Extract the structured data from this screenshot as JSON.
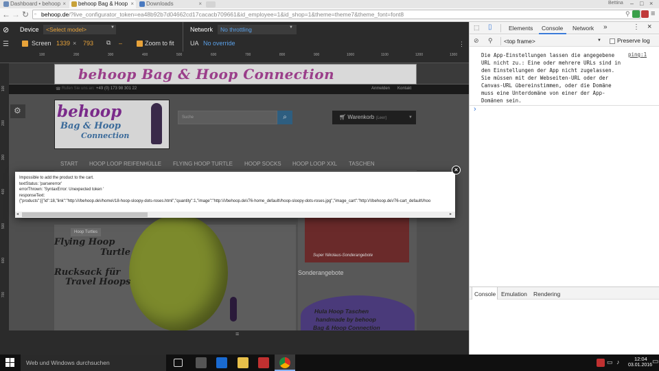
{
  "browser": {
    "tabs": [
      {
        "label": "Dashboard • behoop"
      },
      {
        "label": "behoop Bag & Hoop"
      },
      {
        "label": "Downloads"
      }
    ],
    "window_user": "Bettina",
    "url_domain": "behoop.de",
    "url_rest": "/?live_configurator_token=ea48b92b7d04662cd17cacacb709661&id_employee=1&id_shop=1&theme=theme7&theme_font=font8"
  },
  "device_toolbar": {
    "device_label": "Device",
    "device_select": "<Select model>",
    "screen_label": "Screen",
    "screen_w": "1339",
    "times": "×",
    "screen_h": "793",
    "dash": "–",
    "zoom_label": "Zoom to fit",
    "network_label": "Network",
    "network_value": "No throttling",
    "ua_label": "UA",
    "ua_value": "No override"
  },
  "rulers": {
    "top_ticks": [
      "100",
      "200",
      "300",
      "400",
      "500",
      "600",
      "700",
      "800",
      "900",
      "1000",
      "1100",
      "1200",
      "1300"
    ],
    "left_ticks": [
      "100",
      "200",
      "300",
      "400",
      "500",
      "600",
      "700"
    ]
  },
  "site": {
    "banner": "behoop  Bag & Hoop  Connection",
    "contact_phone": "+49 (0) 173 98 301 22",
    "contact_prefix": "Rufen Sie uns an:",
    "top_links": [
      "Anmelden",
      "Kontakt"
    ],
    "logo_main": "behoop",
    "logo_sub1": "Bag & Hoop",
    "logo_sub2": "Connection",
    "search_placeholder": "Suche",
    "cart_label": "Warenkorb",
    "cart_status": "(Leer)",
    "menu": [
      "START",
      "HOOP LOOP REIFENHÜLLE",
      "FLYING HOOP TURTLE",
      "HOOP SOCKS",
      "HOOP LOOP XXL",
      "TASCHEN"
    ],
    "badge": "Hoop Turtles",
    "headline1a": "Flying Hoop",
    "headline1b": "Turtle",
    "headline2a": "Rucksack für",
    "headline2b": "Travel Hoops",
    "caption1": "Super Nikolaus-Sonderangebote",
    "section_label": "Sonderangebote",
    "caption2a": "Hula Hoop Taschen",
    "caption2b": "handmade by behoop",
    "caption2c": "Bag & Hoop Connection"
  },
  "dialog": {
    "lines": [
      "Impossible to add the product to the cart.",
      "textStatus: 'parsererror'",
      "errorThrown: 'SyntaxError: Unexpected token '",
      "responseText:",
      "{\"products\":[{\"id\":18,\"link\":\"http:\\/\\/behoop.de\\/home\\/18-hoop-sloopy-dots-roses.html\",\"quantity\":1,\"image\":\"http:\\/\\/behoop.de\\/76-home_default\\/hoop-sloopy-dots-roses.jpg\",\"image_cart\":\"http:\\/\\/behoop.de\\/76-cart_default\\/hoo"
    ]
  },
  "devtools": {
    "tabs": [
      "Elements",
      "Console",
      "Network"
    ],
    "active_tab": "Console",
    "frame": "<top frame>",
    "preserve_log": "Preserve log",
    "message": "Die App-Einstellungen lassen die angegebene URL nicht zu.: Eine oder mehrere URLs sind in den Einstellungen der App nicht zugelassen. Sie müssen mit der Webseiten-URL oder der Canvas-URL übereinstimmen, oder die Domäne muss eine Unterdomäne von einer der App-Domänen sein.",
    "message_source": "ping:1",
    "prompt": "›",
    "drawer_tabs": [
      "Console",
      "Emulation",
      "Rendering"
    ]
  },
  "taskbar": {
    "search_placeholder": "Web und Windows durchsuchen",
    "time": "12:04",
    "date": "03.01.2016"
  }
}
